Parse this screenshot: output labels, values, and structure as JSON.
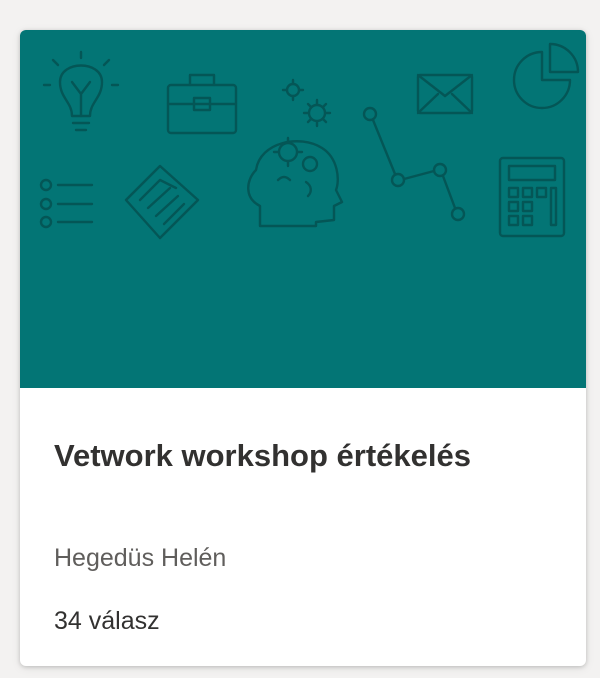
{
  "card": {
    "title": "Vetwork workshop értékelés",
    "owner": "Hegedüs Helén",
    "responses": "34 válasz"
  },
  "theme": {
    "banner_color": "#037575",
    "icon_stroke_color": "#045656",
    "background_color": "#f3f2f1"
  },
  "banner_icons": [
    "lightbulb-icon",
    "briefcase-icon",
    "gears-icon",
    "envelope-icon",
    "pie-chart-icon",
    "list-icon",
    "handshake-icon",
    "head-gears-icon",
    "line-chart-icon",
    "calculator-icon"
  ]
}
